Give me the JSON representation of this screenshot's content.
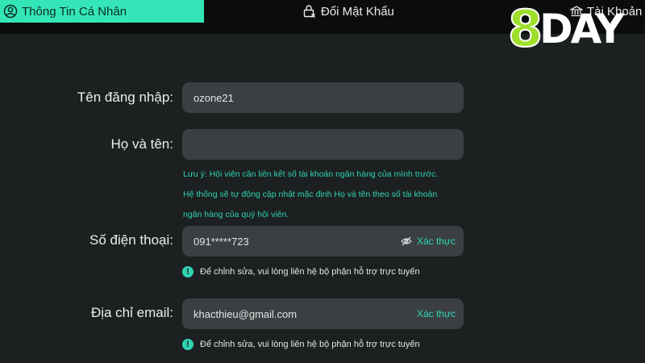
{
  "tabs": {
    "personal_info": "Thông Tin Cá Nhân",
    "change_password": "Đổi Mật Khẩu",
    "bank_account": "Tài Khoản N"
  },
  "logo": {
    "part1": "8",
    "part2": "DAY"
  },
  "form": {
    "username": {
      "label": "Tên đăng nhập:",
      "value": "ozone21"
    },
    "fullname": {
      "label": "Họ và tên:",
      "value": ""
    },
    "note": {
      "line1": "Lưu ý: Hội viên cần liên kết số tài khoản ngân hàng của mình trước.",
      "line2": "Hệ thống sẽ tự động cập nhật mặc định Họ và tên theo số tài khoản",
      "line3": "ngân hàng của quý hội viên."
    },
    "phone": {
      "label": "Số điện thoại:",
      "value": "091*****723",
      "verify": "Xác thực"
    },
    "phone_hint": "Để chỉnh sửa, vui lòng liên hệ bộ phận hỗ trợ trực tuyến",
    "email": {
      "label": "Địa chỉ email:",
      "value": "khacthieu@gmail.com",
      "verify": "Xác thực"
    },
    "email_hint": "Để chỉnh sửa, vui lòng liên hệ bộ phận hỗ trợ trực tuyến"
  },
  "colors": {
    "accent": "#34e6b7",
    "teal_text": "#2fd3b3",
    "logo_green": "#9ddf2a",
    "background": "#1c2021",
    "field": "#3b3f41"
  },
  "icons": [
    "user-circle-icon",
    "lock-icon",
    "bank-icon",
    "eye-off-icon",
    "info-icon"
  ]
}
